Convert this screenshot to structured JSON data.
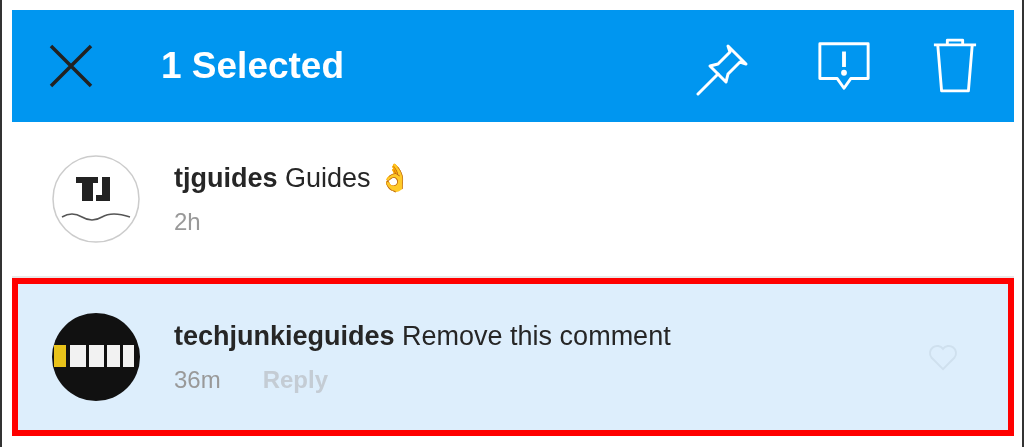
{
  "action_bar": {
    "title": "1 Selected"
  },
  "comments": [
    {
      "username": "tjguides",
      "text": "Guides 👌",
      "time": "2h",
      "selected": false,
      "highlighted": false
    },
    {
      "username": "techjunkieguides",
      "text": "Remove this comment",
      "time": "36m",
      "reply": "Reply",
      "selected": true,
      "highlighted": true
    }
  ]
}
